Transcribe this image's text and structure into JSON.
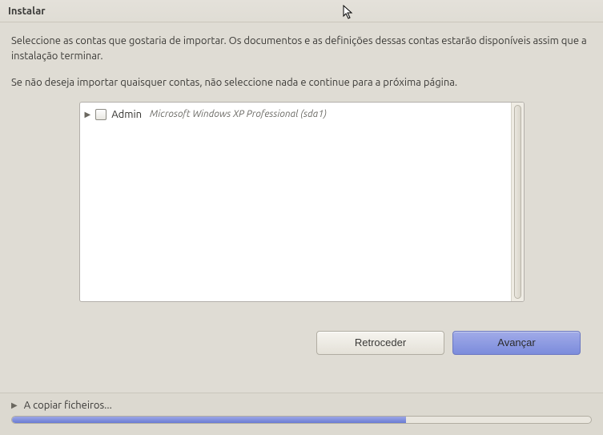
{
  "window": {
    "title": "Instalar"
  },
  "intro": {
    "p1": "Seleccione as contas que gostaria de importar. Os documentos e as definições dessas contas estarão disponíveis assim que a instalação terminar.",
    "p2": "Se não deseja importar quaisquer contas, não seleccione nada e continue para a próxima página."
  },
  "accounts": [
    {
      "name": "Admin",
      "desc": "Microsoft Windows XP Professional (sda1)",
      "checked": false,
      "expanded": false
    }
  ],
  "buttons": {
    "back": "Retroceder",
    "forward": "Avançar"
  },
  "footer": {
    "status": "A copiar ficheiros...",
    "progress_percent": 68
  },
  "colors": {
    "bg": "#dcd9d0",
    "accent": "#7c8cdc"
  }
}
